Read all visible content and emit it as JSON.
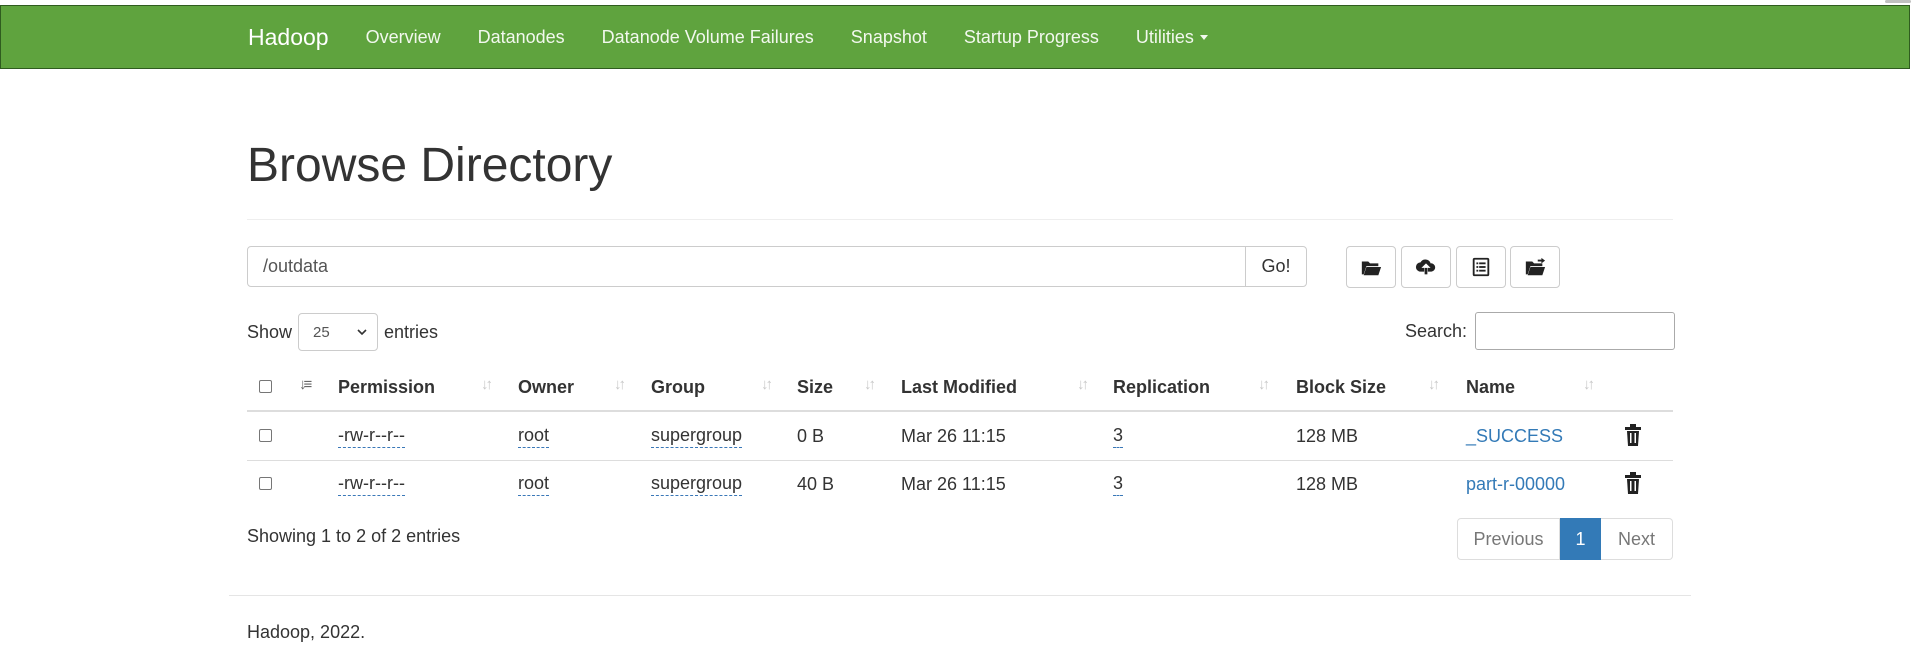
{
  "navbar": {
    "brand": "Hadoop",
    "links": [
      "Overview",
      "Datanodes",
      "Datanode Volume Failures",
      "Snapshot",
      "Startup Progress",
      "Utilities"
    ]
  },
  "page": {
    "title": "Browse Directory"
  },
  "path_bar": {
    "value": "/outdata",
    "go_label": "Go!"
  },
  "toolbar": {
    "icons": [
      "folder-open-icon",
      "cloud-upload-icon",
      "list-icon",
      "folder-move-icon"
    ]
  },
  "controls": {
    "show_label": "Show",
    "page_length": "25",
    "entries_label": "entries",
    "search_label": "Search:"
  },
  "table": {
    "columns": [
      "Permission",
      "Owner",
      "Group",
      "Size",
      "Last Modified",
      "Replication",
      "Block Size",
      "Name"
    ],
    "rows": [
      {
        "permission": "-rw-r--r--",
        "owner": "root",
        "group": "supergroup",
        "size": "0 B",
        "modified": "Mar 26 11:15",
        "replication": "3",
        "block_size": "128 MB",
        "name": "_SUCCESS"
      },
      {
        "permission": "-rw-r--r--",
        "owner": "root",
        "group": "supergroup",
        "size": "40 B",
        "modified": "Mar 26 11:15",
        "replication": "3",
        "block_size": "128 MB",
        "name": "part-r-00000"
      }
    ]
  },
  "info": "Showing 1 to 2 of 2 entries",
  "pagination": {
    "previous": "Previous",
    "current": "1",
    "next": "Next"
  },
  "footer": "Hadoop, 2022.",
  "colors": {
    "navbar": "#5fa33e",
    "link": "#337ab7",
    "active_page": "#337ab7"
  }
}
